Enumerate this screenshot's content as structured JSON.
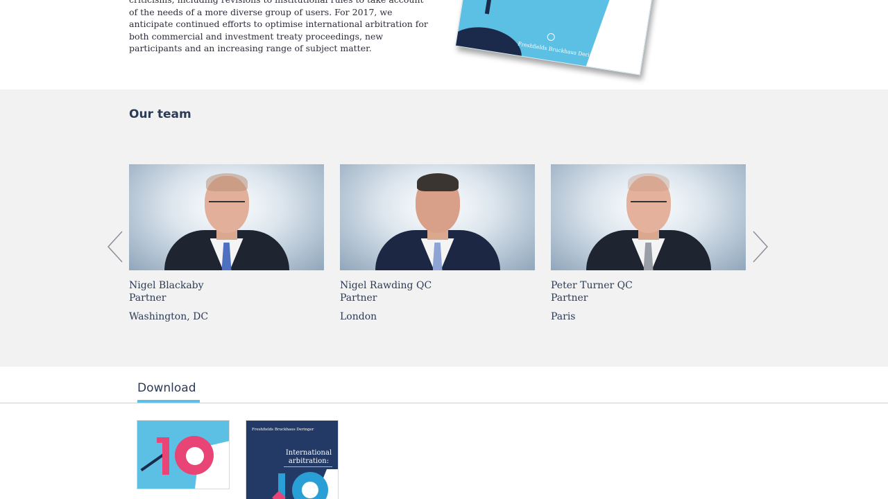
{
  "intro": {
    "paragraph": "criticisms, including revisions to institutional rules to take account of the needs of a more diverse group of users. For 2017, we anticipate continued efforts to optimise international arbitration for both commercial and investment treaty proceedings, new participants and an increasing range of subject matter.",
    "brochure_brand": "Freshfields Bruckhaus Deringer"
  },
  "team": {
    "title": "Our team",
    "members": [
      {
        "name": "Nigel Blackaby",
        "role": "Partner",
        "office": "Washington, DC"
      },
      {
        "name": "Nigel Rawding QC",
        "role": "Partner",
        "office": "London"
      },
      {
        "name": "Peter Turner QC",
        "role": "Partner",
        "office": "Paris"
      }
    ],
    "prev_icon": "chevron-left-icon",
    "next_icon": "chevron-right-icon"
  },
  "download": {
    "tab_label": "Download",
    "items": [
      {
        "kind": "cover-image"
      },
      {
        "kind": "report",
        "brand": "Freshfields Bruckhaus Deringer",
        "title": "International arbitration:"
      }
    ]
  },
  "colors": {
    "accent": "#5bc0e4",
    "navy": "#2b3a55",
    "team_bg": "#f2f2f2",
    "pink": "#e84476"
  }
}
